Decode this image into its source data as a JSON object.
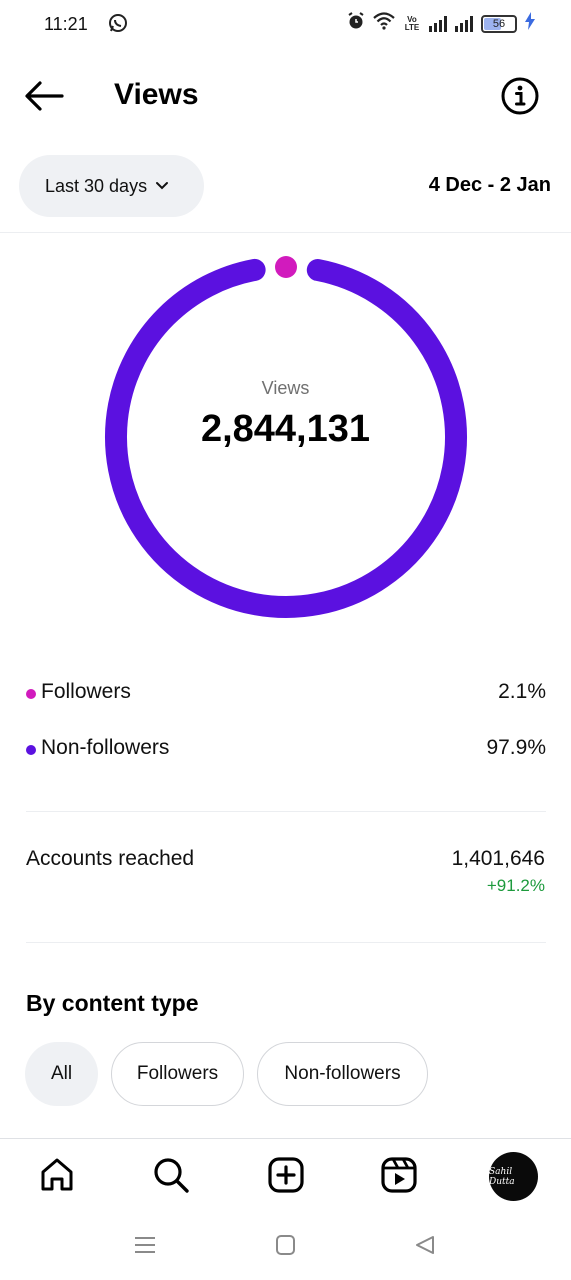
{
  "status_bar": {
    "time": "11:21",
    "battery": "56",
    "volte": "Vo LTE"
  },
  "header": {
    "title": "Views"
  },
  "filter": {
    "range_label": "Last 30 days",
    "date_range": "4 Dec - 2 Jan"
  },
  "chart_data": {
    "type": "pie",
    "title": "",
    "center_label": "Views",
    "center_value": "2,844,131",
    "series": [
      {
        "name": "Followers",
        "value": 2.1,
        "color": "#d11bbd"
      },
      {
        "name": "Non-followers",
        "value": 97.9,
        "color": "#5b11e0"
      }
    ]
  },
  "breakdown": [
    {
      "label": "Followers",
      "value": "2.1%",
      "color": "#d11bbd"
    },
    {
      "label": "Non-followers",
      "value": "97.9%",
      "color": "#5b11e0"
    }
  ],
  "accounts_reached": {
    "label": "Accounts reached",
    "value": "1,401,646",
    "change": "+91.2%"
  },
  "content_type": {
    "title": "By content type",
    "chips": [
      "All",
      "Followers",
      "Non-followers"
    ]
  },
  "bottom_nav": {
    "items": [
      "home-icon",
      "search-icon",
      "create-icon",
      "reels-icon",
      "profile-avatar"
    ],
    "avatar_text": "Sahil Dutta"
  },
  "colors": {
    "followers": "#d11bbd",
    "non_followers": "#5b11e0",
    "positive": "#1d9a3d"
  }
}
